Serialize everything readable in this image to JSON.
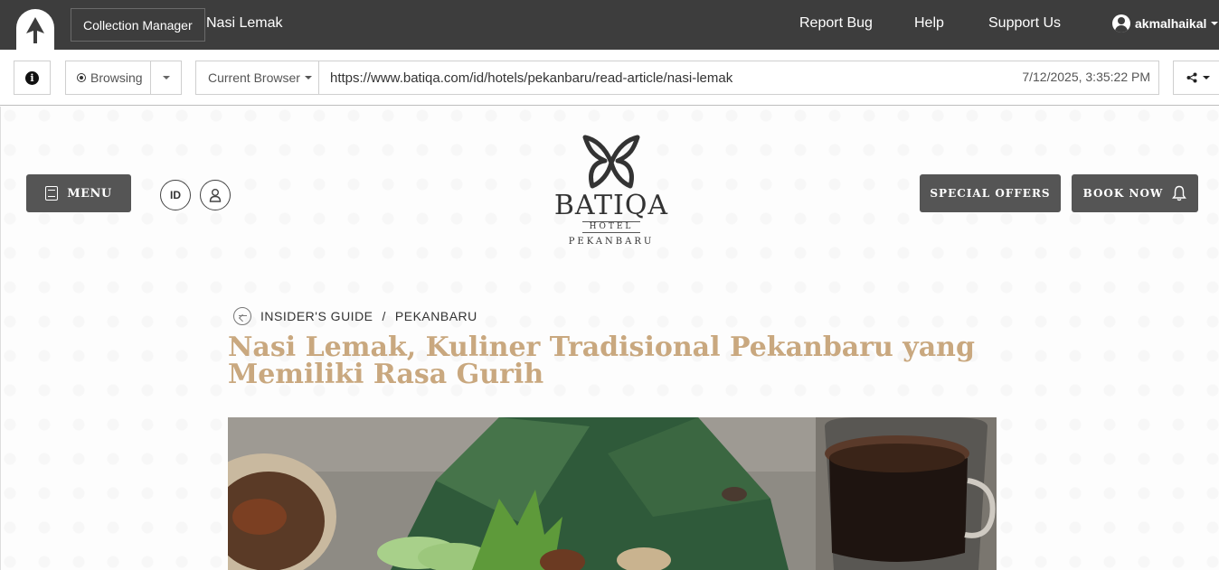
{
  "app": {
    "collection_manager_label": "Collection Manager",
    "collection_title": "Nasi Lemak",
    "nav": [
      "Report Bug",
      "Help",
      "Support Us"
    ],
    "username": "akmalhaikal"
  },
  "toolbar": {
    "mode": "Browsing",
    "browser": "Current Browser",
    "url": "https://www.batiqa.com/id/hotels/pekanbaru/read-article/nasi-lemak",
    "timestamp": "7/12/2025, 3:35:22 PM"
  },
  "page": {
    "menu_label": "MENU",
    "lang_label": "ID",
    "logo": {
      "brand": "BATIQA",
      "sub": "HOTEL",
      "city": "PEKANBARU"
    },
    "special_offers_label": "SPECIAL OFFERS",
    "book_now_label": "BOOK NOW",
    "breadcrumb": {
      "section": "INSIDER'S GUIDE",
      "separator": "/",
      "city": "PEKANBARU"
    },
    "title": "Nasi Lemak, Kuliner Tradisional Pekanbaru yang Memiliki Rasa Gurih"
  },
  "colors": {
    "topbar": "#3d3d3d",
    "title_gold": "#c9a87f",
    "button_dark": "#555555"
  }
}
